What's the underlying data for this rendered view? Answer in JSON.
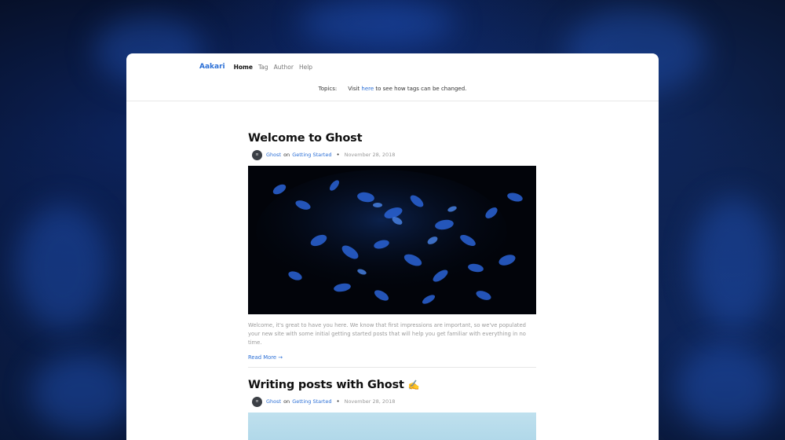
{
  "site": {
    "brand": "Aakari",
    "nav": [
      "Home",
      "Tag",
      "Author",
      "Help"
    ],
    "topics_label": "Topics:",
    "topics_prefix": "Visit ",
    "topics_link": "here",
    "topics_suffix": " to see how tags can be changed."
  },
  "posts": [
    {
      "title": "Welcome to Ghost",
      "author": "Ghost",
      "on": "on",
      "tag": "Getting Started",
      "date": "November 28, 2018",
      "excerpt": "Welcome, it's great to have you here. We know that first impressions are important, so we've populated your new site with some initial getting started posts that will help you get familiar with everything in no time.",
      "read_more": "Read More →"
    },
    {
      "title": "Writing posts with Ghost",
      "title_emoji": "✍️",
      "author": "Ghost",
      "on": "on",
      "tag": "Getting Started",
      "date": "November 28, 2018"
    }
  ],
  "colors": {
    "accent": "#2b6fd6",
    "backdrop": "#04060c"
  },
  "icons": {
    "avatar": "ghost-avatar-icon",
    "date_separator": "bullet-dot"
  }
}
